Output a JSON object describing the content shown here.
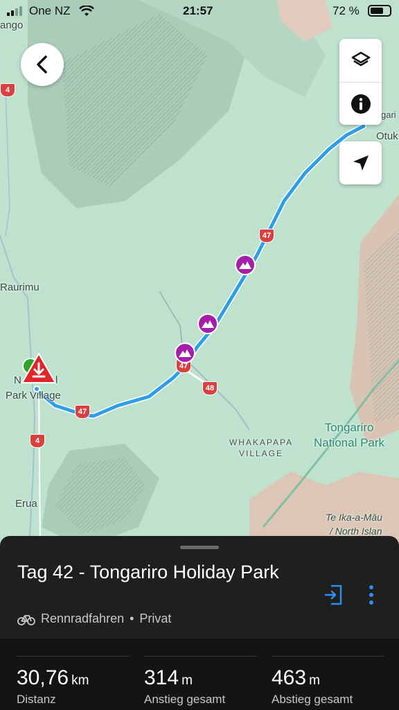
{
  "status_bar": {
    "carrier": "One NZ",
    "time": "21:57",
    "battery": "72 %"
  },
  "map": {
    "labels": {
      "ngango": "ango",
      "raurimu": "Raurimu",
      "national_1": "N",
      "national_2": "l",
      "park_village": "Park Village",
      "erua": "Erua",
      "whakapapa_1": "WHAKAPAPA",
      "whakapapa_2": "VILLAGE",
      "tongariro_1": "Tongariro",
      "tongariro_2": "National Park",
      "otuk": "Otuk",
      "garira": "gari",
      "te_ika": "Te Ika-a-Māu",
      "north_island": "/ North Islan"
    },
    "shields": [
      "4",
      "47",
      "47",
      "47",
      "48",
      "4"
    ],
    "route_color": "#2f9ee8",
    "poi_color": "#a51fa8",
    "start_marker": "download-warning-icon"
  },
  "controls": {
    "back": "chevron-left-icon",
    "layers": "layers-icon",
    "info": "info-icon",
    "locate": "navigation-arrow-icon"
  },
  "sheet": {
    "title": "Tag 42 - Tongariro Holiday Park",
    "activity": "Rennradfahren",
    "separator": "•",
    "visibility": "Privat",
    "stats": [
      {
        "value": "30,76",
        "unit": "km",
        "label": "Distanz"
      },
      {
        "value": "314",
        "unit": "m",
        "label": "Anstieg gesamt"
      },
      {
        "value": "463",
        "unit": "m",
        "label": "Abstieg gesamt"
      }
    ]
  }
}
